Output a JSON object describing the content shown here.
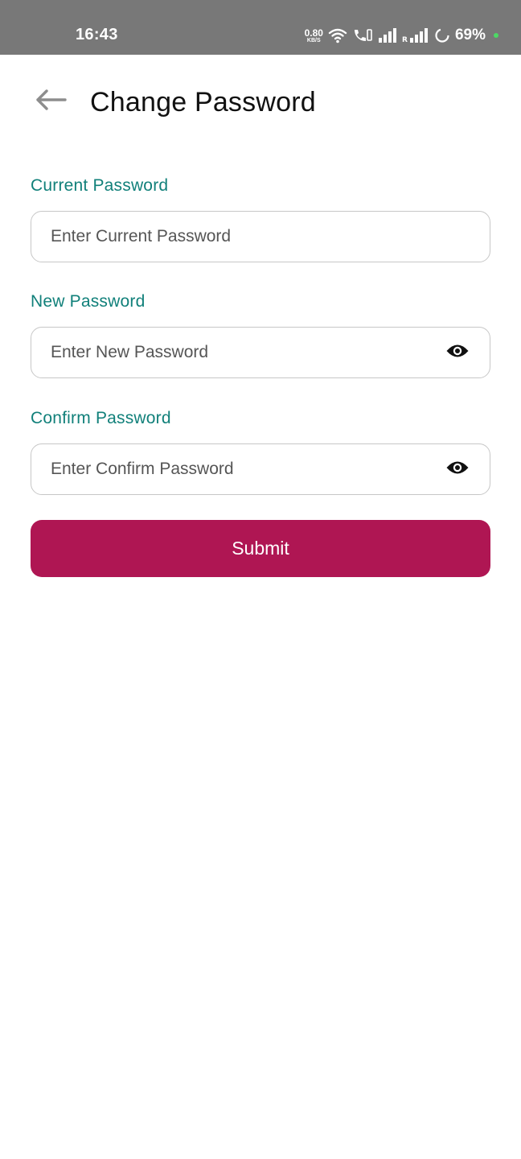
{
  "status_bar": {
    "time": "16:43",
    "net_speed_value": "0.80",
    "net_speed_unit": "KB/S",
    "battery_percent": "69%",
    "icons": [
      "wifi-icon",
      "vowifi-call-icon",
      "signal-icon",
      "roaming-signal-icon",
      "battery-ring-icon"
    ],
    "dot_color": "#4cd964"
  },
  "header": {
    "title": "Change Password",
    "back_icon": "arrow-left-icon"
  },
  "form": {
    "current_password": {
      "label": "Current Password",
      "placeholder": "Enter Current Password"
    },
    "new_password": {
      "label": "New Password",
      "placeholder": "Enter New Password",
      "toggle_icon": "eye-icon"
    },
    "confirm_password": {
      "label": "Confirm Password",
      "placeholder": "Enter Confirm Password",
      "toggle_icon": "eye-icon"
    },
    "submit_label": "Submit"
  },
  "colors": {
    "label": "#11807a",
    "primary": "#af1653",
    "status_bar": "#787878",
    "border": "#c7c7c7"
  }
}
